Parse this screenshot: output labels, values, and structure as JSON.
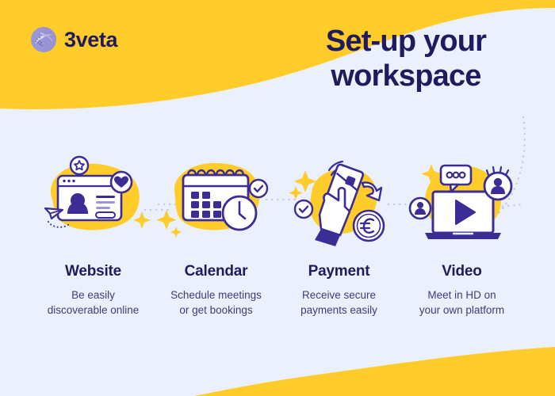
{
  "brand": {
    "name": "3veta",
    "logo_icon": "globe-sphere-icon"
  },
  "header": {
    "title_line1": "Set-up your",
    "title_line2": "workspace"
  },
  "colors": {
    "background": "#eaf1fd",
    "yellow": "#ffcc29",
    "navy": "#201b5e",
    "purple": "#3b2c96",
    "body_text": "#3f3a7a",
    "logo_sphere": "#9a97d6"
  },
  "steps": [
    {
      "id": "website",
      "title": "Website",
      "desc_line1": "Be easily",
      "desc_line2": "discoverable online",
      "icon": "browser-window-profile-icon",
      "badges": [
        "star-badge-icon",
        "heart-badge-icon",
        "paper-plane-icon"
      ]
    },
    {
      "id": "calendar",
      "title": "Calendar",
      "desc_line1": "Schedule meetings",
      "desc_line2": "or get bookings",
      "icon": "spiral-calendar-icon",
      "badges": [
        "clock-icon",
        "check-badge-icon",
        "sparkle-icon"
      ]
    },
    {
      "id": "payment",
      "title": "Payment",
      "desc_line1": "Receive secure",
      "desc_line2": "payments easily",
      "icon": "hand-holding-credit-card-icon",
      "badges": [
        "euro-coin-icon",
        "check-badge-icon",
        "arrow-icon",
        "sparkle-icon",
        "nfc-waves-icon"
      ]
    },
    {
      "id": "video",
      "title": "Video",
      "desc_line1": "Meet in HD on",
      "desc_line2": "your own platform",
      "icon": "laptop-play-button-icon",
      "badges": [
        "chat-bubble-icon",
        "user-avatar-badge-icon",
        "sparkle-icon"
      ]
    }
  ]
}
